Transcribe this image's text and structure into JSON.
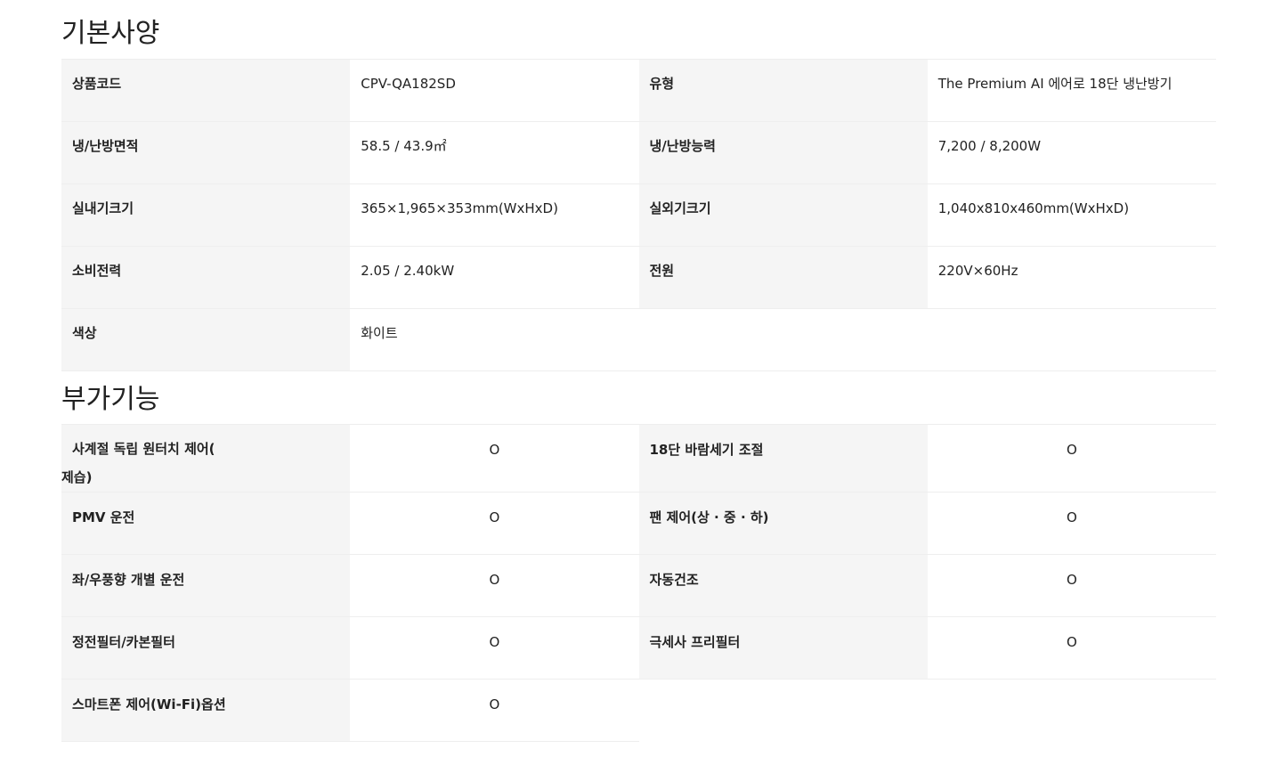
{
  "basic_spec": {
    "title": "기본사양",
    "rows": [
      [
        {
          "label": "상품코드",
          "value": "CPV-QA182SD"
        },
        {
          "label": "유형",
          "value": "The Premium AI 에어로 18단 냉난방기"
        }
      ],
      [
        {
          "label": "냉/난방면적",
          "value": "58.5 / 43.9㎡"
        },
        {
          "label": "냉/난방능력",
          "value": "7,200 / 8,200W"
        }
      ],
      [
        {
          "label": "실내기크기",
          "value": "365×1,965×353mm(WxHxD)"
        },
        {
          "label": "실외기크기",
          "value": "1,040x810x460mm(WxHxD)"
        }
      ],
      [
        {
          "label": "소비전력",
          "value": "2.05 / 2.40kW"
        },
        {
          "label": "전원",
          "value": "220V×60Hz"
        }
      ],
      [
        {
          "label": "색상",
          "value": "화이트"
        },
        {
          "label": "",
          "value": ""
        }
      ]
    ]
  },
  "extra_features": {
    "title": "부가기능",
    "rows": [
      [
        {
          "label_line1": "사계절 독립 원터치 제어(",
          "label_line2": "제습)",
          "value": "O"
        },
        {
          "label": "18단 바람세기 조절",
          "value": "O"
        }
      ],
      [
        {
          "label": "PMV 운전",
          "value": "O"
        },
        {
          "label": "팬 제어(상 · 중 · 하)",
          "value": "O"
        }
      ],
      [
        {
          "label": "좌/우풍향 개별 운전",
          "value": "O"
        },
        {
          "label": "자동건조",
          "value": "O"
        }
      ],
      [
        {
          "label": "정전필터/카본필터",
          "value": "O"
        },
        {
          "label": "극세사 프리필터",
          "value": "O"
        }
      ],
      [
        {
          "label": "스마트폰 제어(Wi-Fi)옵션",
          "value": "O"
        },
        {
          "label": "",
          "value": ""
        }
      ]
    ]
  }
}
